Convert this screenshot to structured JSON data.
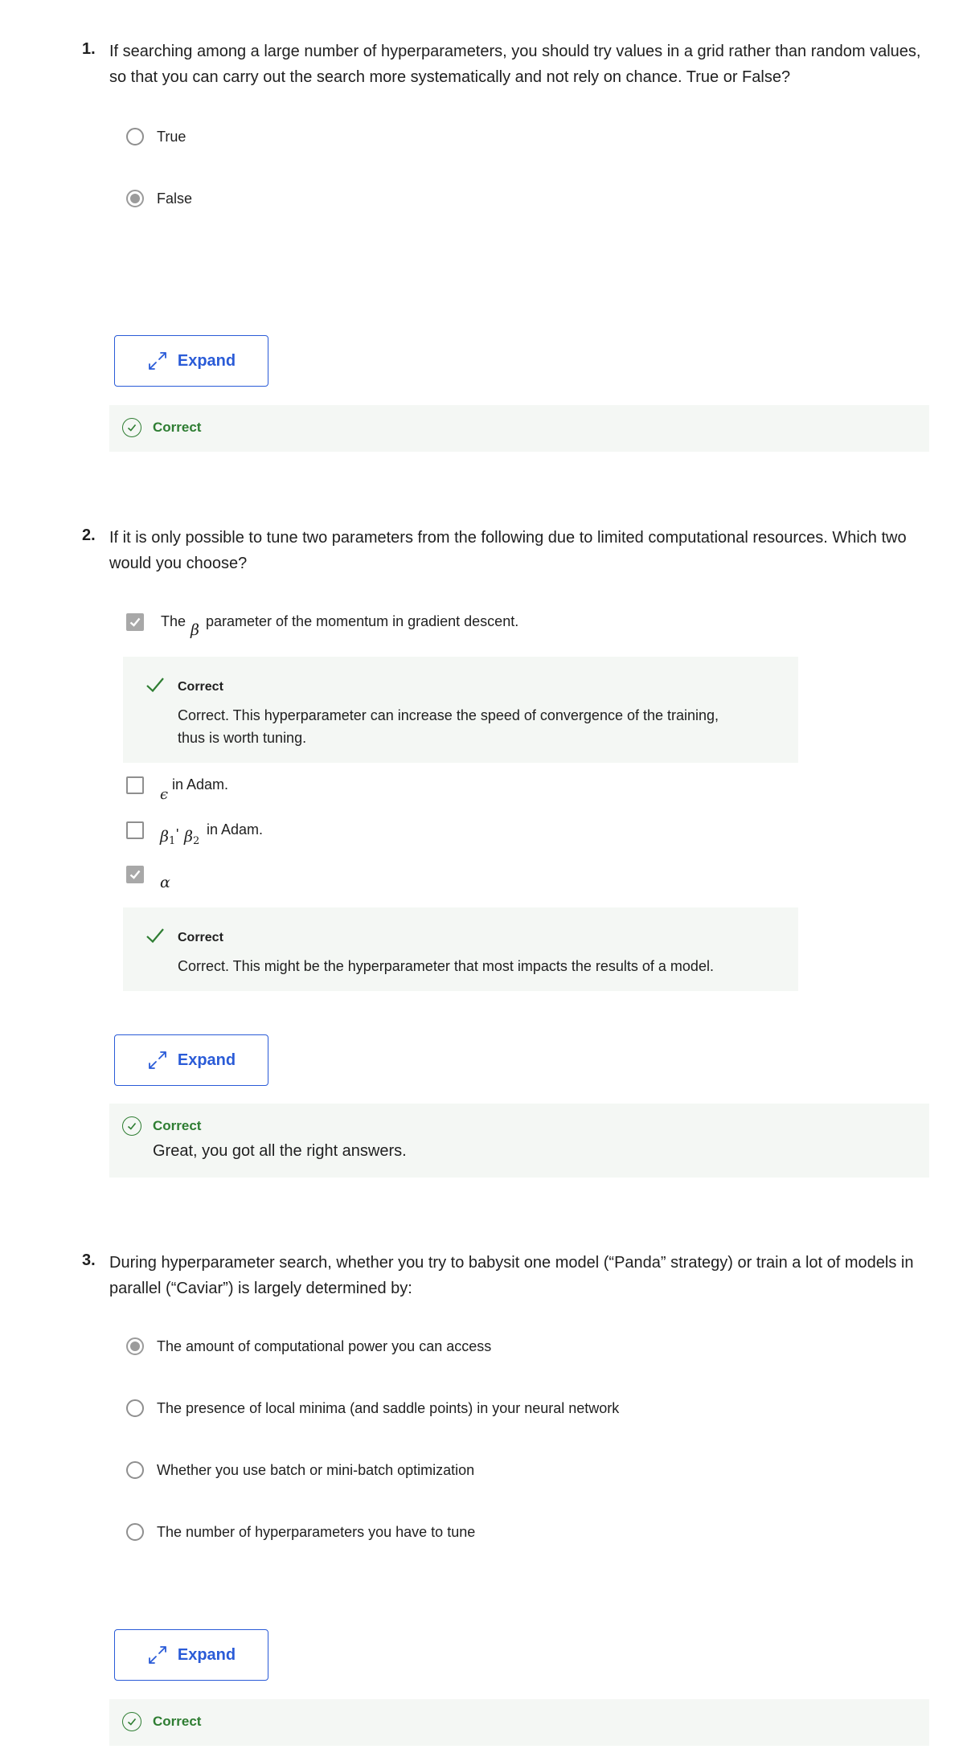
{
  "q1": {
    "number": "1.",
    "text_line1": "If searching among a large number of hyperparameters, you should try values in a grid rather than random values,",
    "text_line2": "so that you can carry out the search more systematically and not rely on chance. True or False?",
    "options": [
      "True",
      "False"
    ],
    "selected": 1,
    "expand_label": "Expand",
    "result_label": "Correct"
  },
  "q2": {
    "number": "2.",
    "text_line1": "If it is only possible to tune two parameters from the following due to limited computational resources. Which two",
    "text_line2": "would you choose?",
    "opt1_pre": "The",
    "opt1_sym": "β",
    "opt1_post": "parameter of the momentum in gradient descent.",
    "fb1_label": "Correct",
    "fb1_line1": "Correct. This hyperparameter can increase the speed of convergence of the training,",
    "fb1_line2": "thus is worth tuning.",
    "opt2_sym": "ϵ",
    "opt2_post": "in Adam.",
    "opt3_sym_a": "β",
    "opt3_sub_a": "1",
    "opt3_sep": "'",
    "opt3_sym_b": "β",
    "opt3_sub_b": "2",
    "opt3_post": "in Adam.",
    "opt4_sym": "α",
    "fb2_label": "Correct",
    "fb2_text": "Correct. This might be the hyperparameter that most impacts the results of a model.",
    "expand_label": "Expand",
    "result_label": "Correct",
    "result_message": "Great, you got all the right answers."
  },
  "q3": {
    "number": "3.",
    "text_line1": "During hyperparameter search, whether you try to babysit one model (“Panda” strategy) or train a lot of models in",
    "text_line2": "parallel (“Caviar”) is largely determined by:",
    "options": [
      "The amount of computational power you can access",
      "The presence of local minima (and saddle points) in your neural network",
      "Whether you use batch or mini-batch optimization",
      "The number of hyperparameters you have to tune"
    ],
    "selected": 0,
    "expand_label": "Expand",
    "result_label": "Correct"
  },
  "colors": {
    "accent": "#2a5bd7",
    "success": "#2e7d32",
    "panel": "#f4f7f4"
  }
}
